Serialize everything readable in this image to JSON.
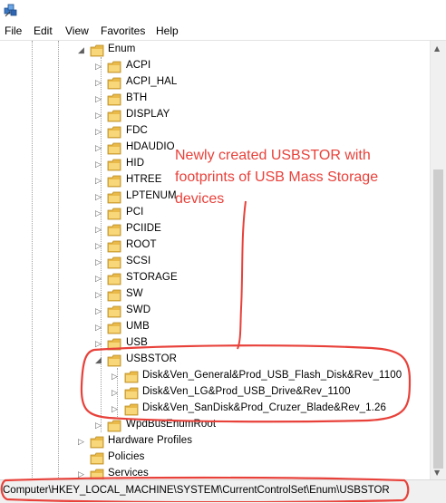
{
  "menu": {
    "file": "File",
    "edit": "Edit",
    "view": "View",
    "favorites": "Favorites",
    "help": "Help"
  },
  "tree": {
    "enum": "Enum",
    "children": [
      "ACPI",
      "ACPI_HAL",
      "BTH",
      "DISPLAY",
      "FDC",
      "HDAUDIO",
      "HID",
      "HTREE",
      "LPTENUM",
      "PCI",
      "PCIIDE",
      "ROOT",
      "SCSI",
      "STORAGE",
      "SW",
      "SWD",
      "UMB",
      "USB"
    ],
    "usbstor": "USBSTOR",
    "usbstor_children": [
      "Disk&Ven_General&Prod_USB_Flash_Disk&Rev_1100",
      "Disk&Ven_LG&Prod_USB_Drive&Rev_1100",
      "Disk&Ven_SanDisk&Prod_Cruzer_Blade&Rev_1.26"
    ],
    "wpdbus": "WpdBusEnumRoot",
    "siblings": [
      "Hardware Profiles",
      "Policies",
      "Services"
    ]
  },
  "annotation": {
    "text": "Newly created USBSTOR with footprints of USB Mass Storage devices"
  },
  "status": {
    "path": "Computer\\HKEY_LOCAL_MACHINE\\SYSTEM\\CurrentControlSet\\Enum\\USBSTOR"
  },
  "colors": {
    "annotation": "#e8413a",
    "folder": "#e9b949",
    "statusbar": "#f0f0f0"
  },
  "icons": {
    "app": "regedit-icon",
    "folder": "folder-icon",
    "collapsed": "triangle-right-icon",
    "expanded": "triangle-down-icon"
  }
}
